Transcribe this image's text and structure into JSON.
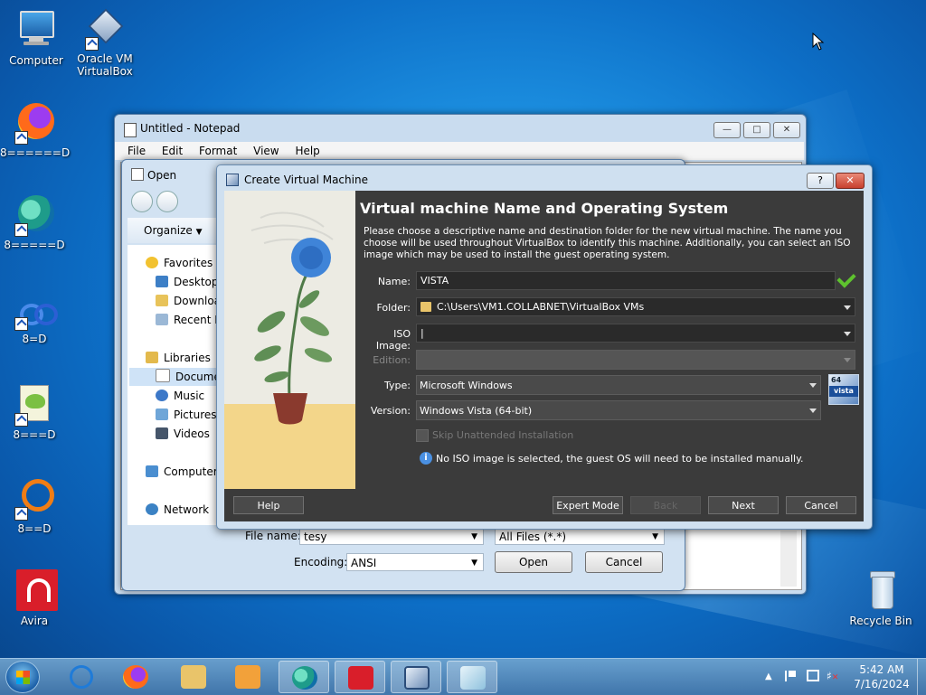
{
  "desktop": {
    "icons": [
      {
        "label": "Computer"
      },
      {
        "label": "Oracle VM VirtualBox"
      },
      {
        "label": "8======D"
      },
      {
        "label": "8=====D"
      },
      {
        "label": "8=D"
      },
      {
        "label": "8===D"
      },
      {
        "label": "8==D"
      },
      {
        "label": "Avira"
      },
      {
        "label": "Recycle Bin"
      }
    ]
  },
  "notepad": {
    "title": "Untitled - Notepad",
    "menu": [
      "File",
      "Edit",
      "Format",
      "View",
      "Help"
    ]
  },
  "open_dialog": {
    "title": "Open",
    "organize": "Organize",
    "tree": {
      "favorites": "Favorites",
      "desktop": "Desktop",
      "downloads": "Downloa",
      "recent": "Recent P",
      "libraries": "Libraries",
      "documents": "Documen",
      "music": "Music",
      "pictures": "Pictures",
      "videos": "Videos",
      "computer": "Computer",
      "network": "Network"
    },
    "file_name_label": "File name:",
    "file_name_value": "tesy",
    "file_type": "All Files  (*.*)",
    "encoding_label": "Encoding:",
    "encoding_value": "ANSI",
    "open_button": "Open",
    "cancel_button": "Cancel"
  },
  "vbox": {
    "title": "Create Virtual Machine",
    "help_glyph": "?",
    "heading": "Virtual machine Name and Operating System",
    "description": "Please choose a descriptive name and destination folder for the new virtual machine. The name you choose will be used throughout VirtualBox to identify this machine. Additionally, you can select an ISO image which may be used to install the guest operating system.",
    "name_label": "Name:",
    "name_value": "VISTA",
    "folder_label": "Folder:",
    "folder_value": "C:\\Users\\VM1.COLLABNET\\VirtualBox VMs",
    "iso_label": "ISO Image:",
    "iso_value": "|",
    "edition_label": "Edition:",
    "edition_value": "",
    "type_label": "Type:",
    "type_value": "Microsoft Windows",
    "version_label": "Version:",
    "version_value": "Windows Vista (64-bit)",
    "badge_top": "64",
    "badge_bottom": "vista",
    "skip_label": "Skip Unattended Installation",
    "info": "No ISO image is selected, the guest OS will need to be installed manually.",
    "buttons": {
      "help": "Help",
      "expert": "Expert Mode",
      "back": "Back",
      "next": "Next",
      "cancel": "Cancel"
    }
  },
  "taskbar": {
    "time": "5:42 AM",
    "date": "7/16/2024"
  },
  "colors": {
    "vbox_bg": "#3b3b3b",
    "title_bar": "#cfe0f0",
    "close_red": "#c8402e",
    "check_green": "#5ec22e"
  }
}
